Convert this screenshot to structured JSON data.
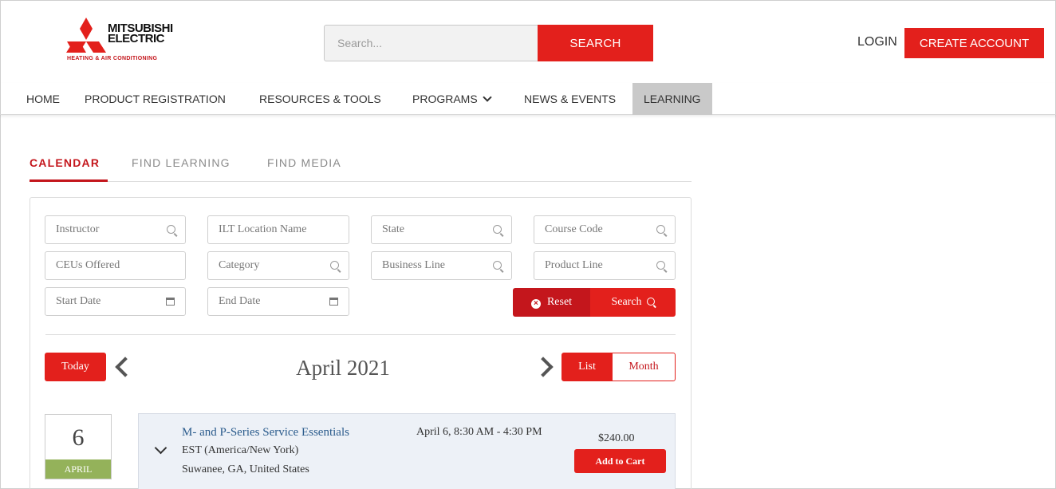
{
  "header": {
    "logo": {
      "brand_line1": "MITSUBISHI",
      "brand_line2": "ELECTRIC",
      "tagline": "HEATING & AIR CONDITIONING"
    },
    "search": {
      "placeholder": "Search...",
      "button_label": "SEARCH"
    },
    "login_label": "LOGIN",
    "create_account_label": "CREATE ACCOUNT"
  },
  "nav": {
    "items": [
      {
        "label": "HOME"
      },
      {
        "label": "PRODUCT REGISTRATION"
      },
      {
        "label": "RESOURCES & TOOLS"
      },
      {
        "label": "PROGRAMS"
      },
      {
        "label": "NEWS & EVENTS"
      },
      {
        "label": "LEARNING",
        "active": true
      }
    ]
  },
  "tabs": [
    {
      "label": "CALENDAR",
      "active": true
    },
    {
      "label": "FIND LEARNING"
    },
    {
      "label": "FIND MEDIA"
    }
  ],
  "filters": {
    "instructor": "Instructor",
    "ilt_location": "ILT Location Name",
    "state": "State",
    "course_code": "Course Code",
    "ceus": "CEUs Offered",
    "category": "Category",
    "business_line": "Business Line",
    "product_line": "Product Line",
    "start_date": "Start Date",
    "end_date": "End Date",
    "reset_label": "Reset",
    "search_label": "Search"
  },
  "calendar": {
    "today_label": "Today",
    "month_title": "April 2021",
    "view_list_label": "List",
    "view_month_label": "Month"
  },
  "event": {
    "day": "6",
    "month": "APRIL",
    "title": "M- and P-Series Service Essentials",
    "timezone": "EST (America/New York)",
    "location": "Suwanee, GA, United States",
    "time": "April 6, 8:30 AM - 4:30 PM",
    "price": "$240.00",
    "cart_label": "Add to Cart"
  },
  "colors": {
    "accent": "#e3201c",
    "brand_red": "#c4161c",
    "date_green": "#94b25a",
    "event_bg": "#edf1f7",
    "link_blue": "#2a5b8c"
  },
  "icons": [
    "mitsubishi-diamonds-logo",
    "chevron-down-icon",
    "search-icon",
    "calendar-icon",
    "close-circle-icon",
    "chevron-left-icon",
    "chevron-right-icon"
  ]
}
